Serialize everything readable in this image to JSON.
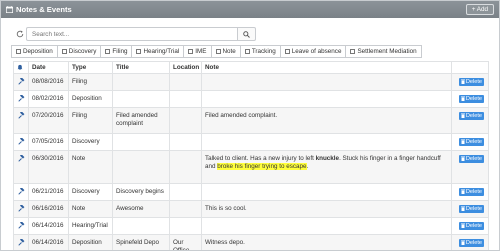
{
  "panel": {
    "title": "Notes & Events",
    "add_label": "+ Add"
  },
  "search": {
    "placeholder": "Search text..."
  },
  "filters": [
    "Deposition",
    "Discovery",
    "Filing",
    "Hearing/Trial",
    "IME",
    "Note",
    "Tracking",
    "Leave of absence",
    "Settlement Mediation"
  ],
  "table": {
    "headers": {
      "date": "Date",
      "type": "Type",
      "title": "Title",
      "location": "Location",
      "note": "Note"
    },
    "delete_label": "Delete",
    "rows": [
      {
        "date": "08/08/2016",
        "type": "Filing",
        "title": "",
        "location": "",
        "note": ""
      },
      {
        "date": "08/02/2016",
        "type": "Deposition",
        "title": "",
        "location": "",
        "note": ""
      },
      {
        "date": "07/20/2016",
        "type": "Filing",
        "title": "Filed amended complaint",
        "location": "",
        "note": "Filed amended complaint."
      },
      {
        "date": "07/05/2016",
        "type": "Discovery",
        "title": "",
        "location": "",
        "note": ""
      },
      {
        "date": "06/30/2016",
        "type": "Note",
        "title": "",
        "location": "",
        "note_parts": {
          "a": "Talked to client. Has a new injury to left ",
          "b": "knuckle",
          "c": ". Stuck his finger in a finger handcuff and ",
          "d": "broke his finger trying to escape",
          "e": "."
        }
      },
      {
        "date": "06/21/2016",
        "type": "Discovery",
        "title": "Discovery begins",
        "location": "",
        "note": ""
      },
      {
        "date": "06/16/2016",
        "type": "Note",
        "title": "Awesome",
        "location": "",
        "note": "This is so cool."
      },
      {
        "date": "06/14/2016",
        "type": "Hearing/Trial",
        "title": "",
        "location": "",
        "note": ""
      },
      {
        "date": "06/14/2016",
        "type": "Deposition",
        "title": "Spinefeld Depo",
        "location": "Our Office",
        "note": "Witness depo."
      }
    ]
  },
  "colors": {
    "header_bg": "#7f868c",
    "delete_button": "#3d8ee0",
    "highlight": "#ffff3b"
  },
  "icons": {
    "panel": "calendar-icon",
    "refresh": "refresh-icon",
    "search": "search-icon",
    "row_type": "gavel-icon",
    "header_alert": "bell-icon",
    "delete": "trash-icon"
  }
}
